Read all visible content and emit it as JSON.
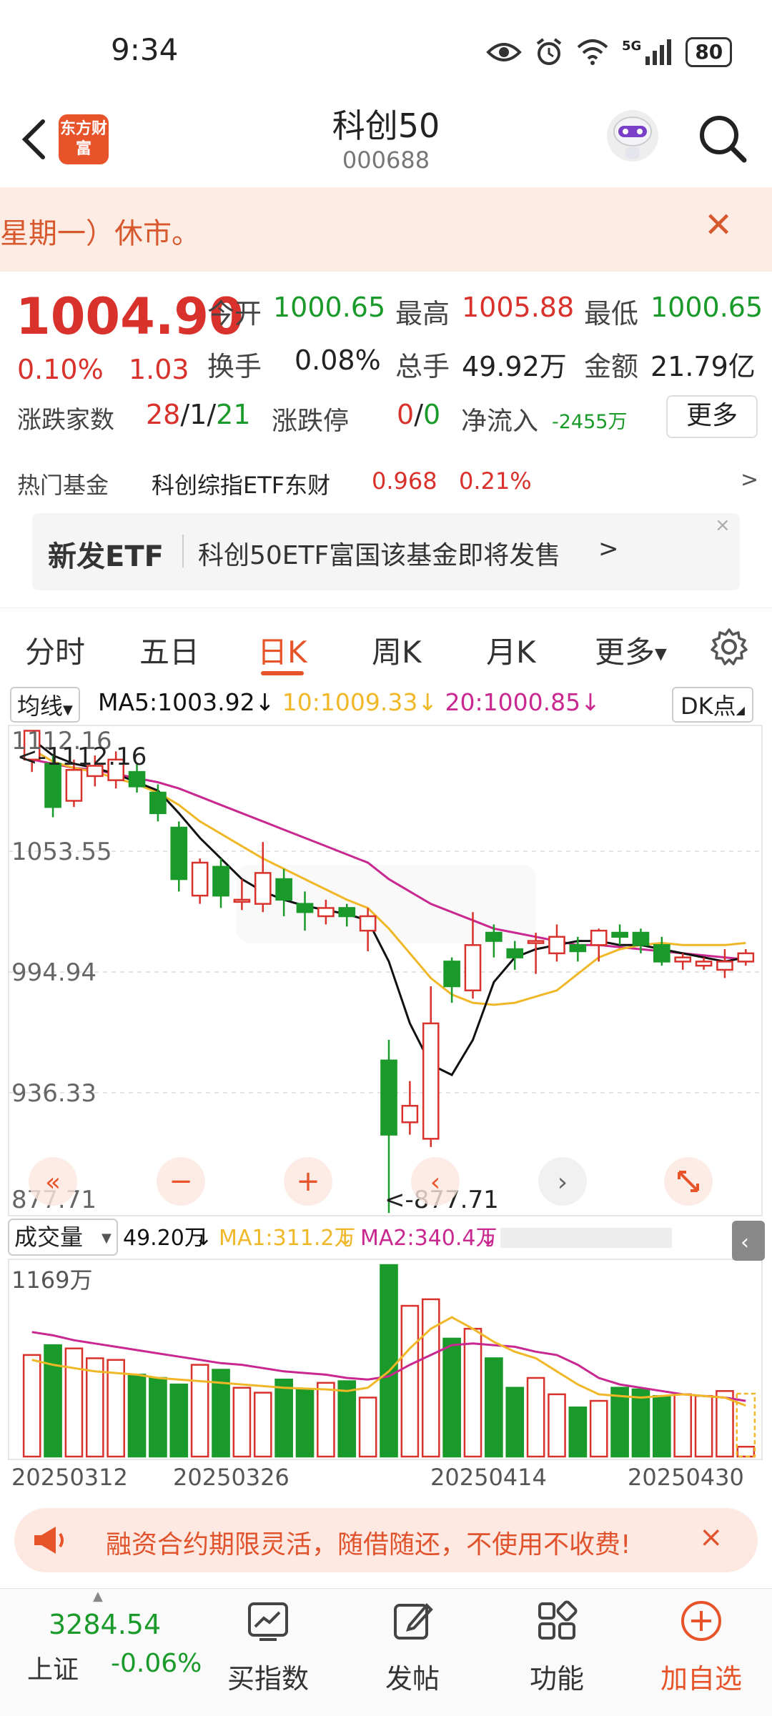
{
  "status": {
    "time": "9:34",
    "battery": "80",
    "net": "5G"
  },
  "header": {
    "title": "科创50",
    "code": "000688",
    "logo_text": "东方财富"
  },
  "notice": {
    "text": "星期一）休市。"
  },
  "quote": {
    "price": "1004.90",
    "change_pct": "0.10%",
    "change_amt": "1.03",
    "open_label": "今开",
    "open": "1000.65",
    "high_label": "最高",
    "high": "1005.88",
    "low_label": "最低",
    "low": "1000.65",
    "turnover_label": "换手",
    "turnover": "0.08%",
    "volume_label": "总手",
    "volume": "49.92万",
    "amount_label": "金额",
    "amount": "21.79亿",
    "updown_label": "涨跌家数",
    "up": "28",
    "flat": "1",
    "down": "21",
    "sep": "/",
    "limit_label": "涨跌停",
    "limit_up": "0",
    "limit_down": "0",
    "netflow_label": "净流入",
    "netflow": "-2455万",
    "more_label": "更多"
  },
  "hot_fund": {
    "label": "热门基金",
    "name": "科创综指ETF东财",
    "price": "0.968",
    "pct": "0.21%",
    "arrow": ">"
  },
  "etf_banner": {
    "tag": "新发ETF",
    "text": "科创50ETF富国该基金即将发售",
    "arrow": ">",
    "close": "×"
  },
  "tabs": [
    {
      "label": "分时"
    },
    {
      "label": "五日"
    },
    {
      "label": "日K"
    },
    {
      "label": "周K"
    },
    {
      "label": "月K"
    },
    {
      "label": "更多"
    }
  ],
  "ma": {
    "selector": "均线",
    "ma5": "MA5:1003.92",
    "ma10": "10:1009.33",
    "ma20": "20:1000.85",
    "down_arrow": "↓",
    "dk": "DK点"
  },
  "volume_bar": {
    "selector": "成交量",
    "vol": "49.20万",
    "ma1": "MA1:311.2万",
    "ma2": "MA2:340.4万",
    "arrow": "↓"
  },
  "ad": {
    "text": "融资合约期限灵活，随借随还，不使用不收费!",
    "close": "×"
  },
  "bottom_nav": {
    "index_value": "3284.54",
    "index_name": "上证",
    "index_pct": "-0.06%",
    "items": [
      {
        "label": "买指数"
      },
      {
        "label": "发帖"
      },
      {
        "label": "功能"
      },
      {
        "label": "加自选"
      }
    ]
  },
  "colors": {
    "up": "#d9312b",
    "down": "#1a9a2a",
    "accent": "#e8542a",
    "ma5": "#111111",
    "ma10": "#f0b828",
    "ma20": "#c8288f"
  },
  "chart_data": {
    "type": "candlestick",
    "title": "",
    "ylim": [
      877.71,
      1112.16
    ],
    "y_ticks": [
      "1112.16",
      "1053.55",
      "994.94",
      "936.33",
      "877.71"
    ],
    "max_label": "<-1112.16",
    "min_label": "<-877.71",
    "x_ticks": [
      "20250312",
      "20250326",
      "20250414",
      "20250430"
    ],
    "candles": [
      {
        "o": 1098,
        "c": 1112,
        "h": 1112,
        "l": 1092
      },
      {
        "o": 1096,
        "c": 1075,
        "h": 1100,
        "l": 1070
      },
      {
        "o": 1078,
        "c": 1093,
        "h": 1098,
        "l": 1075
      },
      {
        "o": 1090,
        "c": 1095,
        "h": 1100,
        "l": 1085
      },
      {
        "o": 1088,
        "c": 1098,
        "h": 1102,
        "l": 1084
      },
      {
        "o": 1092,
        "c": 1085,
        "h": 1096,
        "l": 1082
      },
      {
        "o": 1082,
        "c": 1072,
        "h": 1086,
        "l": 1068
      },
      {
        "o": 1065,
        "c": 1040,
        "h": 1068,
        "l": 1034
      },
      {
        "o": 1032,
        "c": 1048,
        "h": 1050,
        "l": 1028
      },
      {
        "o": 1046,
        "c": 1032,
        "h": 1050,
        "l": 1026
      },
      {
        "o": 1030,
        "c": 1030,
        "h": 1040,
        "l": 1025
      },
      {
        "o": 1028,
        "c": 1043,
        "h": 1058,
        "l": 1024
      },
      {
        "o": 1040,
        "c": 1030,
        "h": 1045,
        "l": 1022
      },
      {
        "o": 1028,
        "c": 1024,
        "h": 1034,
        "l": 1015
      },
      {
        "o": 1022,
        "c": 1026,
        "h": 1030,
        "l": 1018
      },
      {
        "o": 1026,
        "c": 1022,
        "h": 1028,
        "l": 1017
      },
      {
        "o": 1015,
        "c": 1022,
        "h": 1026,
        "l": 1005
      },
      {
        "o": 952,
        "c": 916,
        "h": 962,
        "l": 878
      },
      {
        "o": 922,
        "c": 930,
        "h": 942,
        "l": 916
      },
      {
        "o": 914,
        "c": 970,
        "h": 988,
        "l": 910
      },
      {
        "o": 1000,
        "c": 988,
        "h": 1002,
        "l": 980
      },
      {
        "o": 986,
        "c": 1008,
        "h": 1024,
        "l": 982
      },
      {
        "o": 1014,
        "c": 1010,
        "h": 1018,
        "l": 1002
      },
      {
        "o": 1006,
        "c": 1002,
        "h": 1010,
        "l": 996
      },
      {
        "o": 1010,
        "c": 1010,
        "h": 1014,
        "l": 994
      },
      {
        "o": 1004,
        "c": 1012,
        "h": 1018,
        "l": 1000
      },
      {
        "o": 1008,
        "c": 1005,
        "h": 1012,
        "l": 1000
      },
      {
        "o": 1008,
        "c": 1015,
        "h": 1016,
        "l": 1000
      },
      {
        "o": 1014,
        "c": 1012,
        "h": 1018,
        "l": 1008
      },
      {
        "o": 1014,
        "c": 1008,
        "h": 1016,
        "l": 1004
      },
      {
        "o": 1008,
        "c": 1000,
        "h": 1012,
        "l": 998
      },
      {
        "o": 1000,
        "c": 1002,
        "h": 1004,
        "l": 996
      },
      {
        "o": 998,
        "c": 1000,
        "h": 1002,
        "l": 996
      },
      {
        "o": 996,
        "c": 1000,
        "h": 1006,
        "l": 992
      },
      {
        "o": 1000,
        "c": 1004,
        "h": 1006,
        "l": 998
      }
    ],
    "ma5": [
      1108,
      1100,
      1096,
      1094,
      1091,
      1087,
      1083,
      1072,
      1060,
      1050,
      1040,
      1034,
      1030,
      1027,
      1025,
      1023,
      1020,
      1000,
      970,
      950,
      945,
      962,
      990,
      1002,
      1006,
      1008,
      1010,
      1010,
      1008,
      1008,
      1006,
      1004,
      1002,
      1000,
      1002
    ],
    "ma10": [
      1103,
      1097,
      1094,
      1092,
      1089,
      1086,
      1082,
      1076,
      1068,
      1062,
      1056,
      1050,
      1045,
      1040,
      1035,
      1030,
      1026,
      1016,
      1004,
      992,
      984,
      980,
      979,
      980,
      983,
      986,
      994,
      1002,
      1006,
      1008,
      1009,
      1008,
      1008,
      1008,
      1009
    ],
    "ma20": [
      1098,
      1096,
      1094,
      1093,
      1091,
      1089,
      1087,
      1084,
      1080,
      1076,
      1072,
      1068,
      1064,
      1060,
      1056,
      1052,
      1048,
      1040,
      1034,
      1028,
      1024,
      1020,
      1016,
      1014,
      1012,
      1010,
      1008,
      1008,
      1007,
      1006,
      1005,
      1004,
      1003,
      1002,
      1001
    ],
    "volume_ylim": [
      0,
      1169
    ],
    "volume_label_top": "1169万",
    "volume": [
      620,
      680,
      660,
      600,
      590,
      500,
      480,
      440,
      560,
      530,
      420,
      390,
      470,
      410,
      450,
      460,
      360,
      1169,
      920,
      960,
      720,
      780,
      600,
      420,
      480,
      380,
      300,
      340,
      420,
      410,
      370,
      380,
      370,
      400,
      60
    ],
    "vol_ma1": [
      590,
      560,
      540,
      520,
      510,
      500,
      480,
      470,
      460,
      450,
      440,
      430,
      420,
      415,
      410,
      400,
      420,
      520,
      660,
      780,
      850,
      780,
      700,
      640,
      600,
      520,
      440,
      380,
      370,
      360,
      370,
      380,
      370,
      360,
      311
    ],
    "vol_ma2": [
      760,
      740,
      710,
      690,
      670,
      650,
      630,
      610,
      590,
      570,
      560,
      540,
      520,
      510,
      500,
      480,
      470,
      490,
      560,
      620,
      680,
      690,
      680,
      670,
      640,
      620,
      560,
      480,
      440,
      420,
      400,
      380,
      370,
      360,
      340
    ]
  }
}
